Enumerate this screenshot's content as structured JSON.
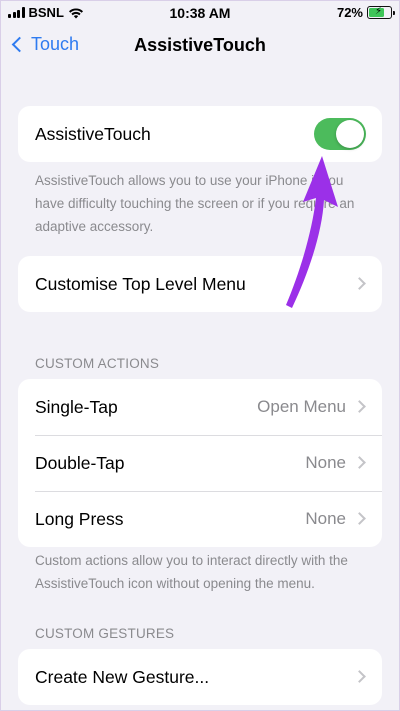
{
  "status_bar": {
    "carrier": "BSNL",
    "time": "10:38 AM",
    "battery": "72%",
    "battery_level": 0.72
  },
  "nav": {
    "back_label": "Touch",
    "title": "AssistiveTouch"
  },
  "toggle_group": {
    "label": "AssistiveTouch",
    "enabled": true,
    "footnote": "AssistiveTouch allows you to use your iPhone if you have difficulty touching the screen or if you require an adaptive accessory."
  },
  "menu_group": {
    "label": "Customise Top Level Menu"
  },
  "custom_actions": {
    "header": "CUSTOM ACTIONS",
    "rows": [
      {
        "label": "Single-Tap",
        "value": "Open Menu"
      },
      {
        "label": "Double-Tap",
        "value": "None"
      },
      {
        "label": "Long Press",
        "value": "None"
      }
    ],
    "footnote": "Custom actions allow you to interact directly with the AssistiveTouch icon without opening the menu."
  },
  "custom_gestures": {
    "header": "CUSTOM GESTURES",
    "create_label": "Create New Gesture..."
  },
  "colors": {
    "accent": "#2f7bf0",
    "toggle_on": "#4cbb5c",
    "annotation_arrow": "#9b30e8"
  },
  "icons": [
    "signal-icon",
    "wifi-icon",
    "battery-icon",
    "chevron-left-icon",
    "chevron-right-icon",
    "arrow-annotation"
  ]
}
